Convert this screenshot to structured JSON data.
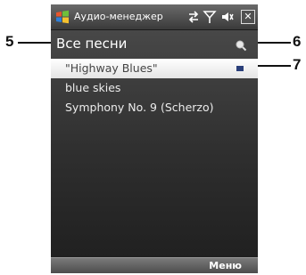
{
  "status_bar": {
    "app_title": "Аудио-менеджер",
    "close_label": "✕"
  },
  "header": {
    "title": "Все песни"
  },
  "songs": [
    "\"Highway Blues\"",
    "blue skies",
    "Symphony No. 9 (Scherzo)"
  ],
  "softkeys": {
    "right": "Меню"
  },
  "callouts": {
    "c5": "5",
    "c6": "6",
    "c7": "7"
  },
  "colors": {
    "selection_marker": "#2a3f7a"
  }
}
